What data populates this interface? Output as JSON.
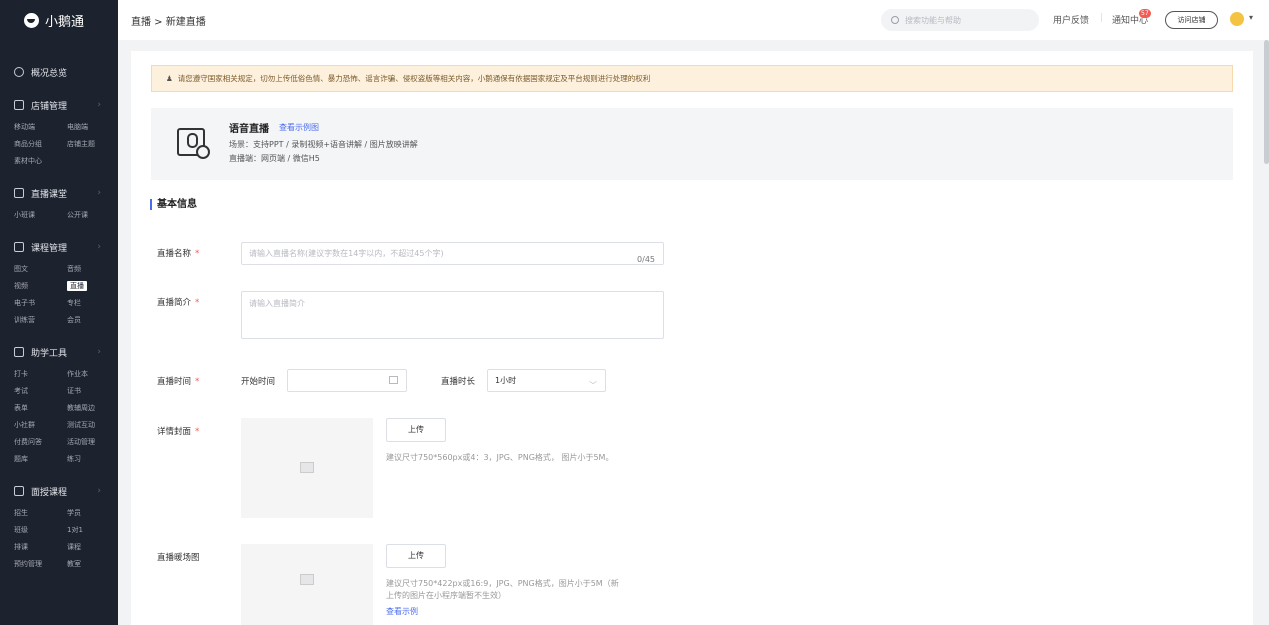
{
  "app": {
    "logo": "小鹅通"
  },
  "sidebar": {
    "overview": "概况总览",
    "sections": [
      {
        "title": "店铺管理",
        "icon": "store-icon",
        "items": [
          "移动端",
          "电脑端",
          "商品分组",
          "店铺主题",
          "素材中心"
        ]
      },
      {
        "title": "直播课堂",
        "icon": "video-icon",
        "items": [
          "小班课",
          "公开课"
        ]
      },
      {
        "title": "课程管理",
        "icon": "course-icon",
        "items": [
          "图文",
          "音频",
          "视频",
          "直播",
          "电子书",
          "专栏",
          "训练营",
          "会员"
        ]
      },
      {
        "title": "助学工具",
        "icon": "toolbox-icon",
        "items": [
          "打卡",
          "作业本",
          "考试",
          "证书",
          "表单",
          "教辅周边",
          "小社群",
          "测试互动",
          "付费问答",
          "活动管理",
          "题库",
          "练习"
        ]
      },
      {
        "title": "面授课程",
        "icon": "classroom-icon",
        "items": [
          "招生",
          "学员",
          "班级",
          "1对1",
          "排课",
          "课程",
          "预约管理",
          "教室"
        ]
      }
    ],
    "active_item": "直播"
  },
  "topbar": {
    "breadcrumb": "直播 > 新建直播",
    "search_placeholder": "搜索功能与帮助",
    "feedback": "用户反馈",
    "notify": "通知中心",
    "notify_badge": "57",
    "visit_store": "访问店铺",
    "caret": "▾"
  },
  "notice": "请您遵守国家相关规定，切勿上传低俗色情、暴力恐怖、谣言诈骗、侵权盗版等相关内容，小鹅通保有依据国家规定及平台规则进行处理的权利",
  "type_box": {
    "title": "语音直播",
    "example_link": "查看示例图",
    "scene": "场景：支持PPT / 录制视频+语音讲解 / 图片放映讲解",
    "platform": "直播端：网页端 / 微信H5"
  },
  "form": {
    "section_title": "基本信息",
    "name_label": "直播名称",
    "name_placeholder": "请输入直播名称(建议字数在14字以内，不超过45个字)",
    "name_counter": "0/45",
    "intro_label": "直播简介",
    "intro_placeholder": "请输入直播简介",
    "time_label": "直播时间",
    "start_label": "开始时间",
    "duration_label": "直播时长",
    "duration_value": "1小时",
    "cover_label": "详情封面",
    "cover_upload": "上传",
    "cover_hint": "建议尺寸750*560px或4：3，JPG、PNG格式， 图片小于5M。",
    "warmup_label": "直播暖场图",
    "warmup_upload": "上传",
    "warmup_hint_1": "建议尺寸750*422px或16:9，JPG、PNG格式，图片小于5M（新",
    "warmup_hint_2": "上传的图片在小程序端暂不生效）",
    "warmup_example": "查看示例",
    "required_mark": "*"
  }
}
